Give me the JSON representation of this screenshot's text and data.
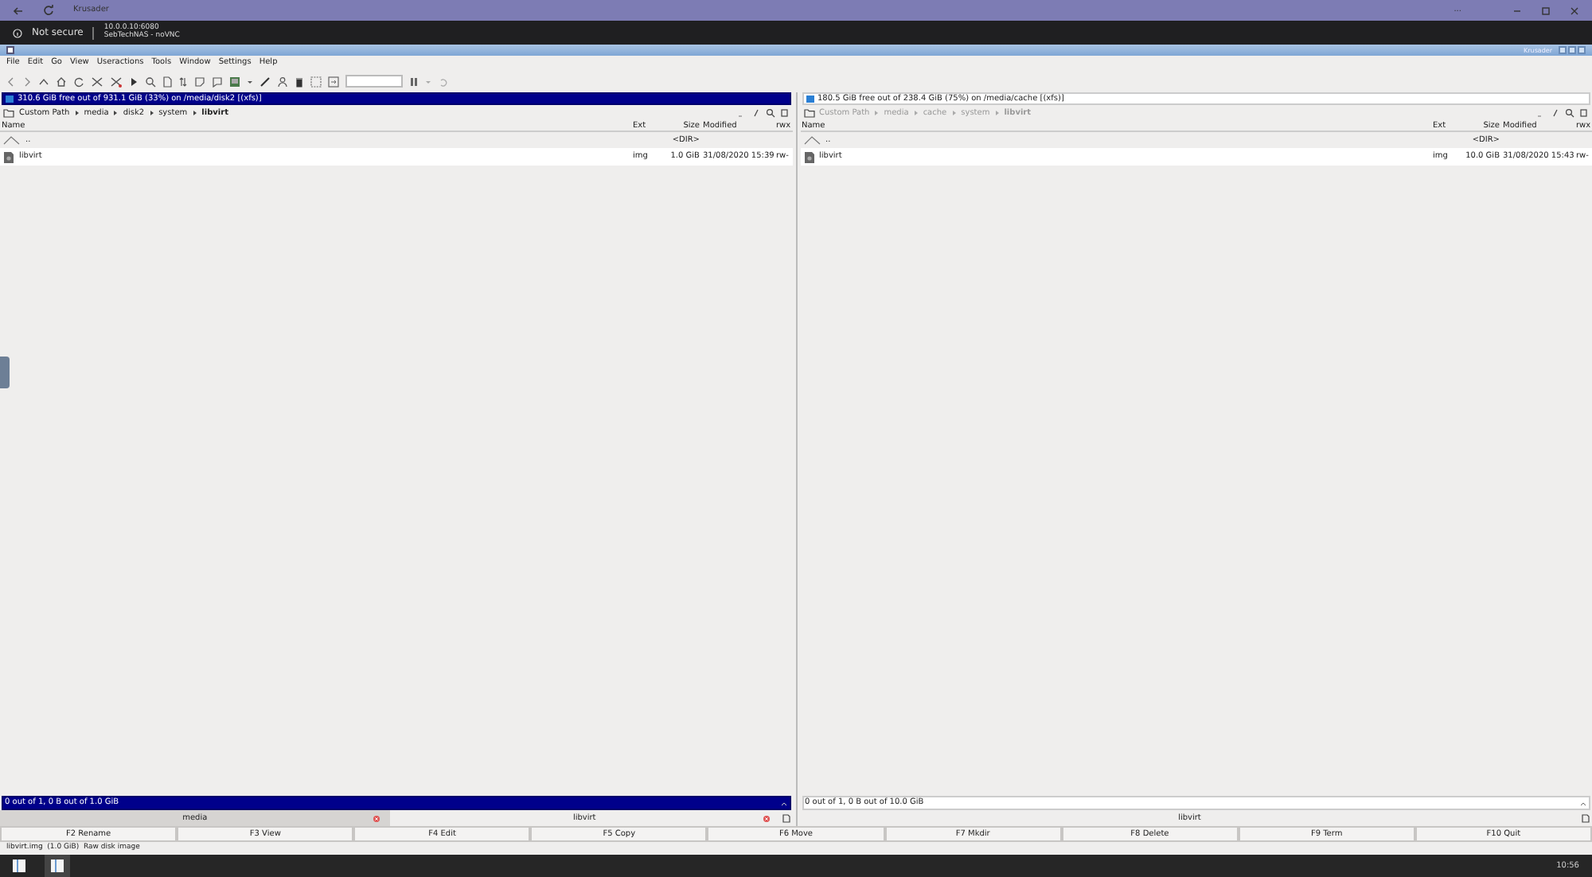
{
  "browser": {
    "title": "Krusader",
    "security": "Not secure",
    "address": "10.0.0.10:6080",
    "page_title": "SebTechNAS - noVNC",
    "more": "..."
  },
  "window": {
    "title": "Krusader"
  },
  "menu": [
    "File",
    "Edit",
    "Go",
    "View",
    "Useractions",
    "Tools",
    "Window",
    "Settings",
    "Help"
  ],
  "panels": [
    {
      "selected": true,
      "free_space": "310.6 GiB free out of 931.1 GiB (33%) on /media/disk2 [(xfs)]",
      "path": [
        "Custom Path",
        "media",
        "disk2",
        "system"
      ],
      "current": "libvirt",
      "columns": [
        "Name",
        "Ext",
        "Size",
        "Modified",
        "rwx"
      ],
      "rows": [
        {
          "kind": "up",
          "name": "..",
          "size": "<DIR>"
        },
        {
          "kind": "file",
          "name": "libvirt",
          "ext": "img",
          "size": "1.0 GiB",
          "modified": "31/08/2020 15:39",
          "rwx": "rw-"
        }
      ],
      "summary": "0 out of 1, 0 B out of 1.0 GiB",
      "tabs": [
        {
          "label": "media",
          "selected": false
        },
        {
          "label": "libvirt",
          "selected": true
        }
      ]
    },
    {
      "selected": false,
      "free_space": "180.5 GiB free out of 238.4 GiB (75%) on /media/cache [(xfs)]",
      "path": [
        "Custom Path",
        "media",
        "cache",
        "system"
      ],
      "current": "libvirt",
      "columns": [
        "Name",
        "Ext",
        "Size",
        "Modified",
        "rwx"
      ],
      "rows": [
        {
          "kind": "up",
          "name": "..",
          "size": "<DIR>"
        },
        {
          "kind": "file",
          "name": "libvirt",
          "ext": "img",
          "size": "10.0 GiB",
          "modified": "31/08/2020 15:43",
          "rwx": "rw-"
        }
      ],
      "summary": "0 out of 1, 0 B out of 10.0 GiB",
      "tabs": [
        {
          "label": "libvirt",
          "selected": true
        }
      ]
    }
  ],
  "function_keys": [
    "F2 Rename",
    "F3 View",
    "F4 Edit",
    "F5 Copy",
    "F6 Move",
    "F7 Mkdir",
    "F8 Delete",
    "F9 Term",
    "F10 Quit"
  ],
  "status": "libvirt.img  (1.0 GiB)  Raw disk image",
  "clock": "10:56"
}
